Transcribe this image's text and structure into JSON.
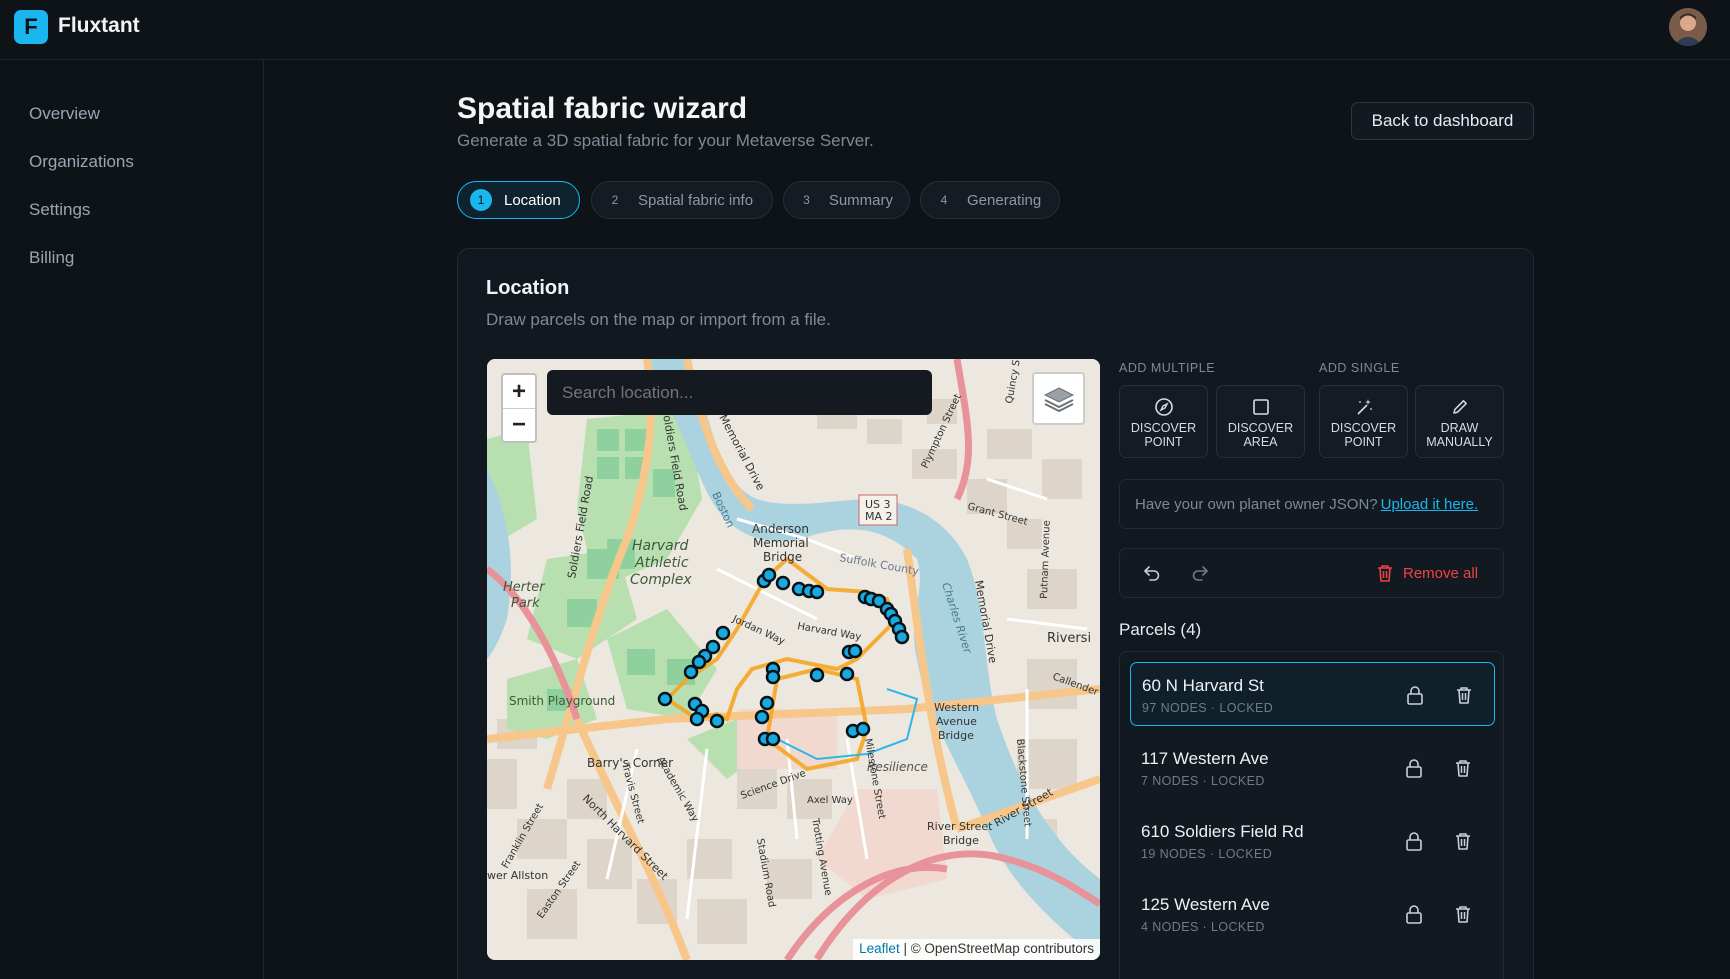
{
  "app": {
    "logo_letter": "F",
    "name": "Fluxtant"
  },
  "sidebar": {
    "items": [
      {
        "label": "Overview"
      },
      {
        "label": "Organizations"
      },
      {
        "label": "Settings"
      },
      {
        "label": "Billing"
      }
    ]
  },
  "header": {
    "title": "Spatial fabric wizard",
    "subtitle": "Generate a 3D spatial fabric for your Metaverse Server.",
    "back_button": "Back to dashboard"
  },
  "steps": [
    {
      "num": "1",
      "label": "Location",
      "active": true
    },
    {
      "num": "2",
      "label": "Spatial fabric info",
      "active": false
    },
    {
      "num": "3",
      "label": "Summary",
      "active": false
    },
    {
      "num": "4",
      "label": "Generating",
      "active": false
    }
  ],
  "location": {
    "title": "Location",
    "subtitle": "Draw parcels on the map or import from a file."
  },
  "map": {
    "search_placeholder": "Search location...",
    "zoom_in": "+",
    "zoom_out": "−",
    "attribution_leaflet": "Leaflet",
    "attribution_rest": " | © OpenStreetMap contributors",
    "labels": {
      "soldiers_field_road": "Soldiers Field Road",
      "memorial_drive": "Memorial Drive",
      "boston": "Boston",
      "plympton": "Plympton Street",
      "quincy": "Quincy S",
      "us3_a": "US 3",
      "us3_b": "MA 2",
      "anderson_a": "Anderson",
      "anderson_b": "Memorial",
      "anderson_c": "Bridge",
      "harvard_a": "Harvard",
      "harvard_b": "Athletic",
      "harvard_c": "Complex",
      "herter_a": "Herter",
      "herter_b": "Park",
      "suffolk": "Suffolk County",
      "charles": "Charles River",
      "memorial_drive_2": "Memorial Drive",
      "harvard_way": "Harvard Way",
      "jordan_way": "Jordan Way",
      "smith": "Smith Playground",
      "barrys": "Barry's Corner",
      "western_a": "Western",
      "western_b": "Avenue",
      "western_c": "Bridge",
      "resilience": "Resilience",
      "river_street_a": "River Street",
      "river_street_b": "Bridge",
      "river_street": "River Street",
      "north_harvard": "North Harvard Street",
      "allston": "wer Allston",
      "axel": "Axel Way",
      "science": "Science Drive",
      "milestone": "Milestone Street",
      "rivers": "Riversi",
      "grant": "Grant Street",
      "putnam": "Putnam Avenue",
      "academic": "Academic Way",
      "stadium": "Stadium Road",
      "trotting": "Trotting Avenue",
      "travis": "Travis Street",
      "franklin": "Franklin Street",
      "easton": "Easton Street",
      "blackstone": "Blackstone Street",
      "callender": "Callender"
    }
  },
  "tools": {
    "add_multiple_label": "ADD MULTIPLE",
    "add_single_label": "ADD SINGLE",
    "discover_point_multi_1": "DISCOVER",
    "discover_point_multi_2": "POINT",
    "discover_area_1": "DISCOVER",
    "discover_area_2": "AREA",
    "discover_point_single_1": "DISCOVER",
    "discover_point_single_2": "POINT",
    "draw_manually_1": "DRAW",
    "draw_manually_2": "MANUALLY"
  },
  "upload": {
    "text": "Have your own planet owner JSON?",
    "link": "Upload it here."
  },
  "actions": {
    "remove_all": "Remove all"
  },
  "parcels": {
    "title": "Parcels (4)",
    "items": [
      {
        "name": "60 N Harvard St",
        "meta": "97 NODES · LOCKED",
        "selected": true
      },
      {
        "name": "117 Western Ave",
        "meta": "7 NODES · LOCKED",
        "selected": false
      },
      {
        "name": "610 Soldiers Field Rd",
        "meta": "19 NODES · LOCKED",
        "selected": false
      },
      {
        "name": "125 Western Ave",
        "meta": "4 NODES · LOCKED",
        "selected": false
      }
    ]
  },
  "colors": {
    "accent": "#1ab6ef",
    "danger": "#ef4444",
    "background": "#0e1318"
  }
}
